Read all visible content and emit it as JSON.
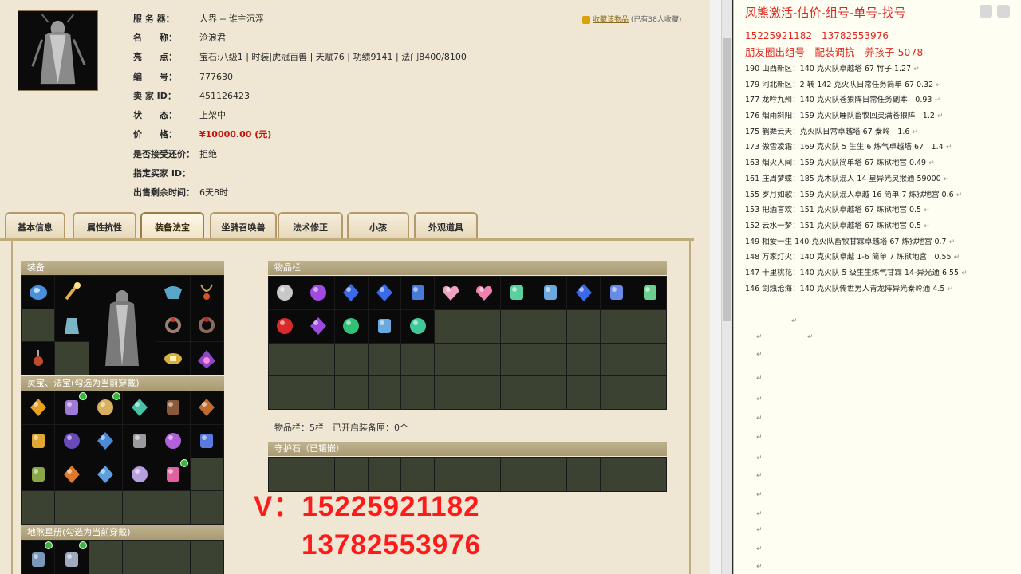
{
  "listing": {
    "server_label": "服 务 器：",
    "server_value": "人界 -- 谁主沉浮",
    "name_label": "名　　称：",
    "name_value": "沧浪君",
    "highlight_label": "亮　　点：",
    "highlight_value": "宝石:八级1 | 时装|虎冠百兽 | 天赋76 | 功绩9141 | 法门8400/8100",
    "number_label": "编　　号：",
    "number_value": "777630",
    "seller_label": "卖 家 ID：",
    "seller_value": "451126423",
    "status_label": "状　　态：",
    "status_value": "上架中",
    "price_label": "价　　格：",
    "price_value": "¥10000.00 (元)",
    "bargain_label": "是否接受还价：",
    "bargain_value": "拒绝",
    "buyer_label": "指定买家 ID：",
    "buyer_value": "",
    "time_label": "出售剩余时间：",
    "time_value": "6天8时",
    "fav_link": "收藏该物品",
    "fav_count": "(已有38人收藏)"
  },
  "tabs": [
    {
      "label": "基本信息",
      "active": false
    },
    {
      "label": "属性抗性",
      "active": false
    },
    {
      "label": "装备法宝",
      "active": true
    },
    {
      "label": "坐骑召唤兽",
      "active": false
    },
    {
      "label": "法术修正",
      "active": false
    },
    {
      "label": "小孩",
      "active": false
    },
    {
      "label": "外观道具",
      "active": false
    }
  ],
  "panels": {
    "equipment_title": "装备",
    "lingbao_title": "灵宝、法宝(勾选为当前穿戴)",
    "starbook_title": "地煞星册(勾选为当前穿戴)",
    "items_title": "物品栏",
    "items_note": "物品栏：5栏　已开启装备匣：0个",
    "guard_title": "守护石（已镶嵌）"
  },
  "watermark": {
    "line1": "V：15225921182",
    "line2": "13782553976"
  },
  "doc": {
    "title": "风熊激活-估价-组号-单号-找号",
    "phones": "15225921182　13782553976",
    "subtitle": "朋友圈出组号　配装调抗　养孩子 5078",
    "lines": [
      "190 山西新区：140 克火队卓越塔 67 竹子 1.27",
      "179 河北新区：2 转 142 克火队日常任务简单 67 0.32",
      "177 龙吟九州：140 克火队苍狼阵日常任务副本　0.93",
      "176 烟雨斜阳：159 克火队睡队畜牧回灵满苍狼阵　1.2",
      "175 鹤舞云天：克火队日常卓越塔 67 秦岭　1.6",
      "173 傲雪凌霜：169 克火队 5 生生 6 炼气卓越塔 67　1.4",
      "163 烟火人间：159 克火队简单塔 67 炼狱地宫 0.49",
      "161 庄周梦蝶：185 克木队混人 14 星异光灵猴通 59000",
      "155 岁月如歌：159 克火队混人卓越 16 简单 7 炼狱地宫 0.6",
      "153 把酒言欢：151 克火队卓越塔 67 炼狱地宫 0.5",
      "152 云水一梦：151 克火队卓越塔 67 炼狱地宫 0.5",
      "149 相爱一生 140 克火队畜牧甘霖卓越塔 67 炼狱地宫 0.7",
      "148 万家灯火：140 克火队卓越 1-6 简单 7 炼狱地宫　0.55",
      "147 十里桃花：140 克火队 5 级生生炼气甘霖 14-异光通 6.55",
      "146 剑烛沧海：140 克火队传世男人青龙阵异光秦岭通 4.5"
    ],
    "return_mark": "↵"
  },
  "colors": {
    "price": "#c0140c",
    "watermark": "#ff1a1a",
    "doc_red": "#e0261e",
    "slot_bg": "#3c4232"
  },
  "icons": {
    "fav": "star-bag-icon",
    "corner": [
      "chat-icon",
      "window-icon"
    ]
  }
}
